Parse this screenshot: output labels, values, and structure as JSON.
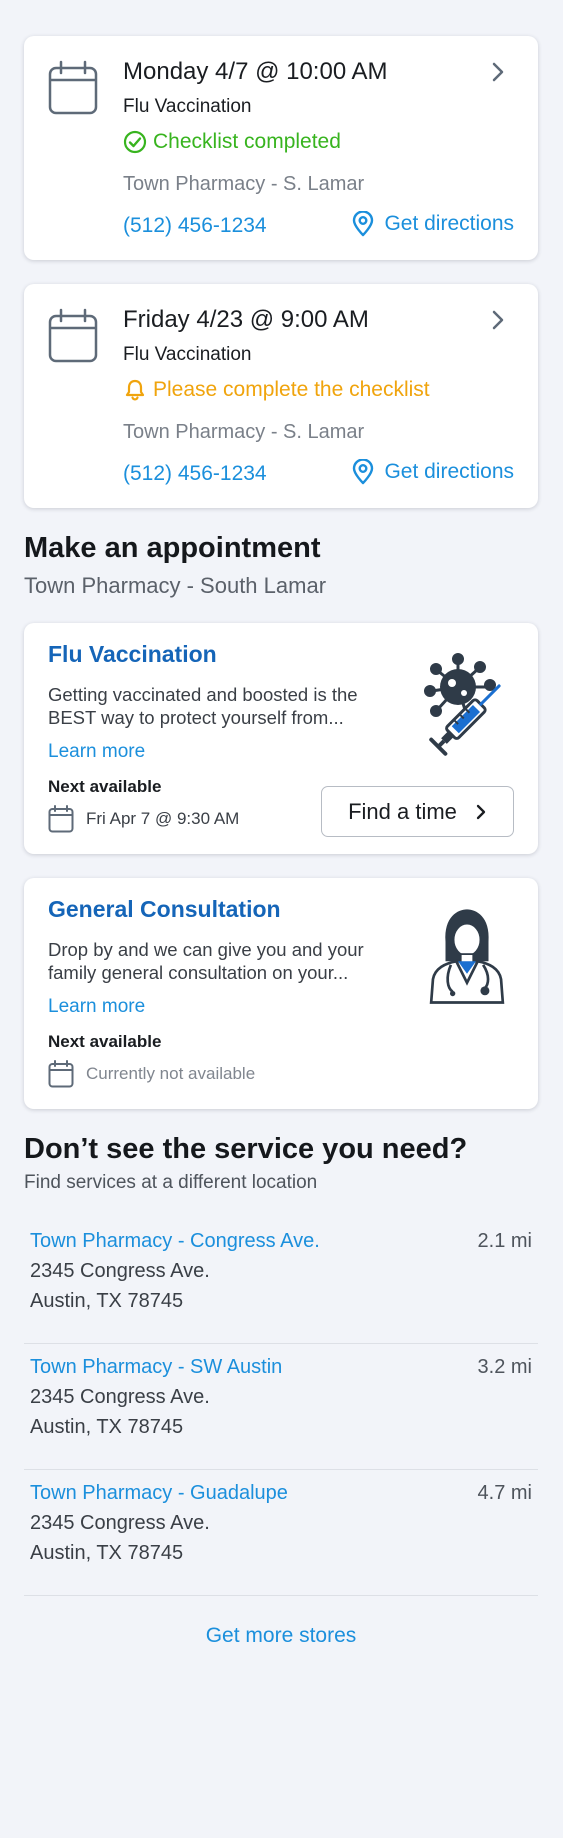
{
  "appointments": [
    {
      "datetime": "Monday 4/7 @ 10:00 AM",
      "service": "Flu Vaccination",
      "status": "Checklist completed",
      "status_type": "completed",
      "location": "Town Pharmacy - S. Lamar",
      "phone": "(512) 456-1234",
      "directions": "Get directions"
    },
    {
      "datetime": "Friday 4/23 @ 9:00 AM",
      "service": "Flu Vaccination",
      "status": "Please complete the checklist",
      "status_type": "pending",
      "location": "Town Pharmacy - S. Lamar",
      "phone": "(512) 456-1234",
      "directions": "Get directions"
    }
  ],
  "make_appointment": {
    "title": "Make an appointment",
    "subtitle": "Town Pharmacy - South Lamar",
    "services": [
      {
        "name": "Flu Vaccination",
        "description": "Getting vaccinated and boosted is the BEST way to protect yourself from...",
        "learn_more": "Learn more",
        "next_label": "Next available",
        "next_value": "Fri Apr 7 @ 9:30 AM",
        "button": "Find a time",
        "icon": "virus-syringe-icon"
      },
      {
        "name": "General Consultation",
        "description": "Drop by and we can give you and your family general consultation on your...",
        "learn_more": "Learn more",
        "next_label": "Next available",
        "next_value": "Currently not available",
        "icon": "doctor-icon"
      }
    ]
  },
  "other_locations": {
    "title": "Don’t see the service you need?",
    "subtitle": "Find services at a different location",
    "stores": [
      {
        "name": "Town Pharmacy - Congress Ave.",
        "distance": "2.1 mi",
        "address1": "2345 Congress Ave.",
        "address2": "Austin, TX 78745"
      },
      {
        "name": "Town Pharmacy - SW Austin",
        "distance": "3.2 mi",
        "address1": "2345 Congress Ave.",
        "address2": "Austin, TX 78745"
      },
      {
        "name": "Town Pharmacy - Guadalupe",
        "distance": "4.7 mi",
        "address1": "2345 Congress Ave.",
        "address2": "Austin, TX 78745"
      }
    ],
    "more": "Get more stores"
  },
  "colors": {
    "background": "#f2f4f9",
    "link": "#1b8fdc",
    "heading_blue": "#1565b8",
    "success": "#38b41f",
    "warning": "#f0a40d",
    "icon_gray": "#5e6a78"
  }
}
